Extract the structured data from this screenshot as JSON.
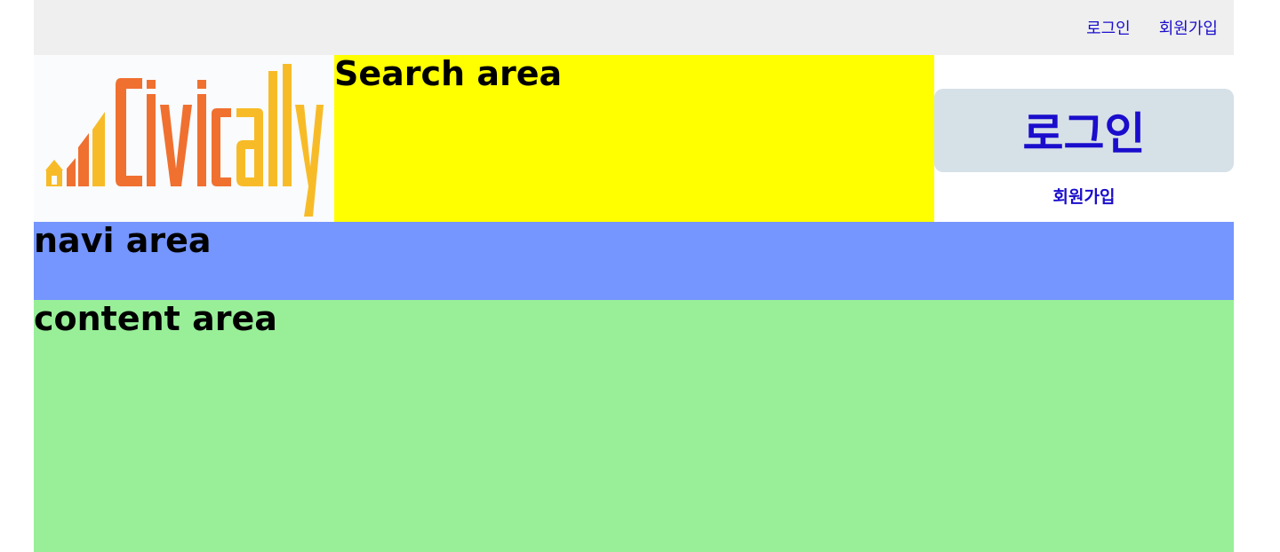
{
  "topbar": {
    "login_label": "로그인",
    "signup_label": "회원가입"
  },
  "logo": {
    "text": "Civically",
    "colors": {
      "orange": "#f07030",
      "yellow": "#f8bb28"
    }
  },
  "search": {
    "title": "Search area",
    "background": "#ffff00"
  },
  "login_box": {
    "login_label": "로그인",
    "signup_label": "회원가입",
    "button_background": "#d6e0e7"
  },
  "navi": {
    "title": "navi area",
    "background": "#7595ff"
  },
  "content": {
    "title": "content area",
    "background": "#98ef98"
  },
  "colors": {
    "link": "#1a0dcc",
    "topbar_background": "#efefef"
  }
}
